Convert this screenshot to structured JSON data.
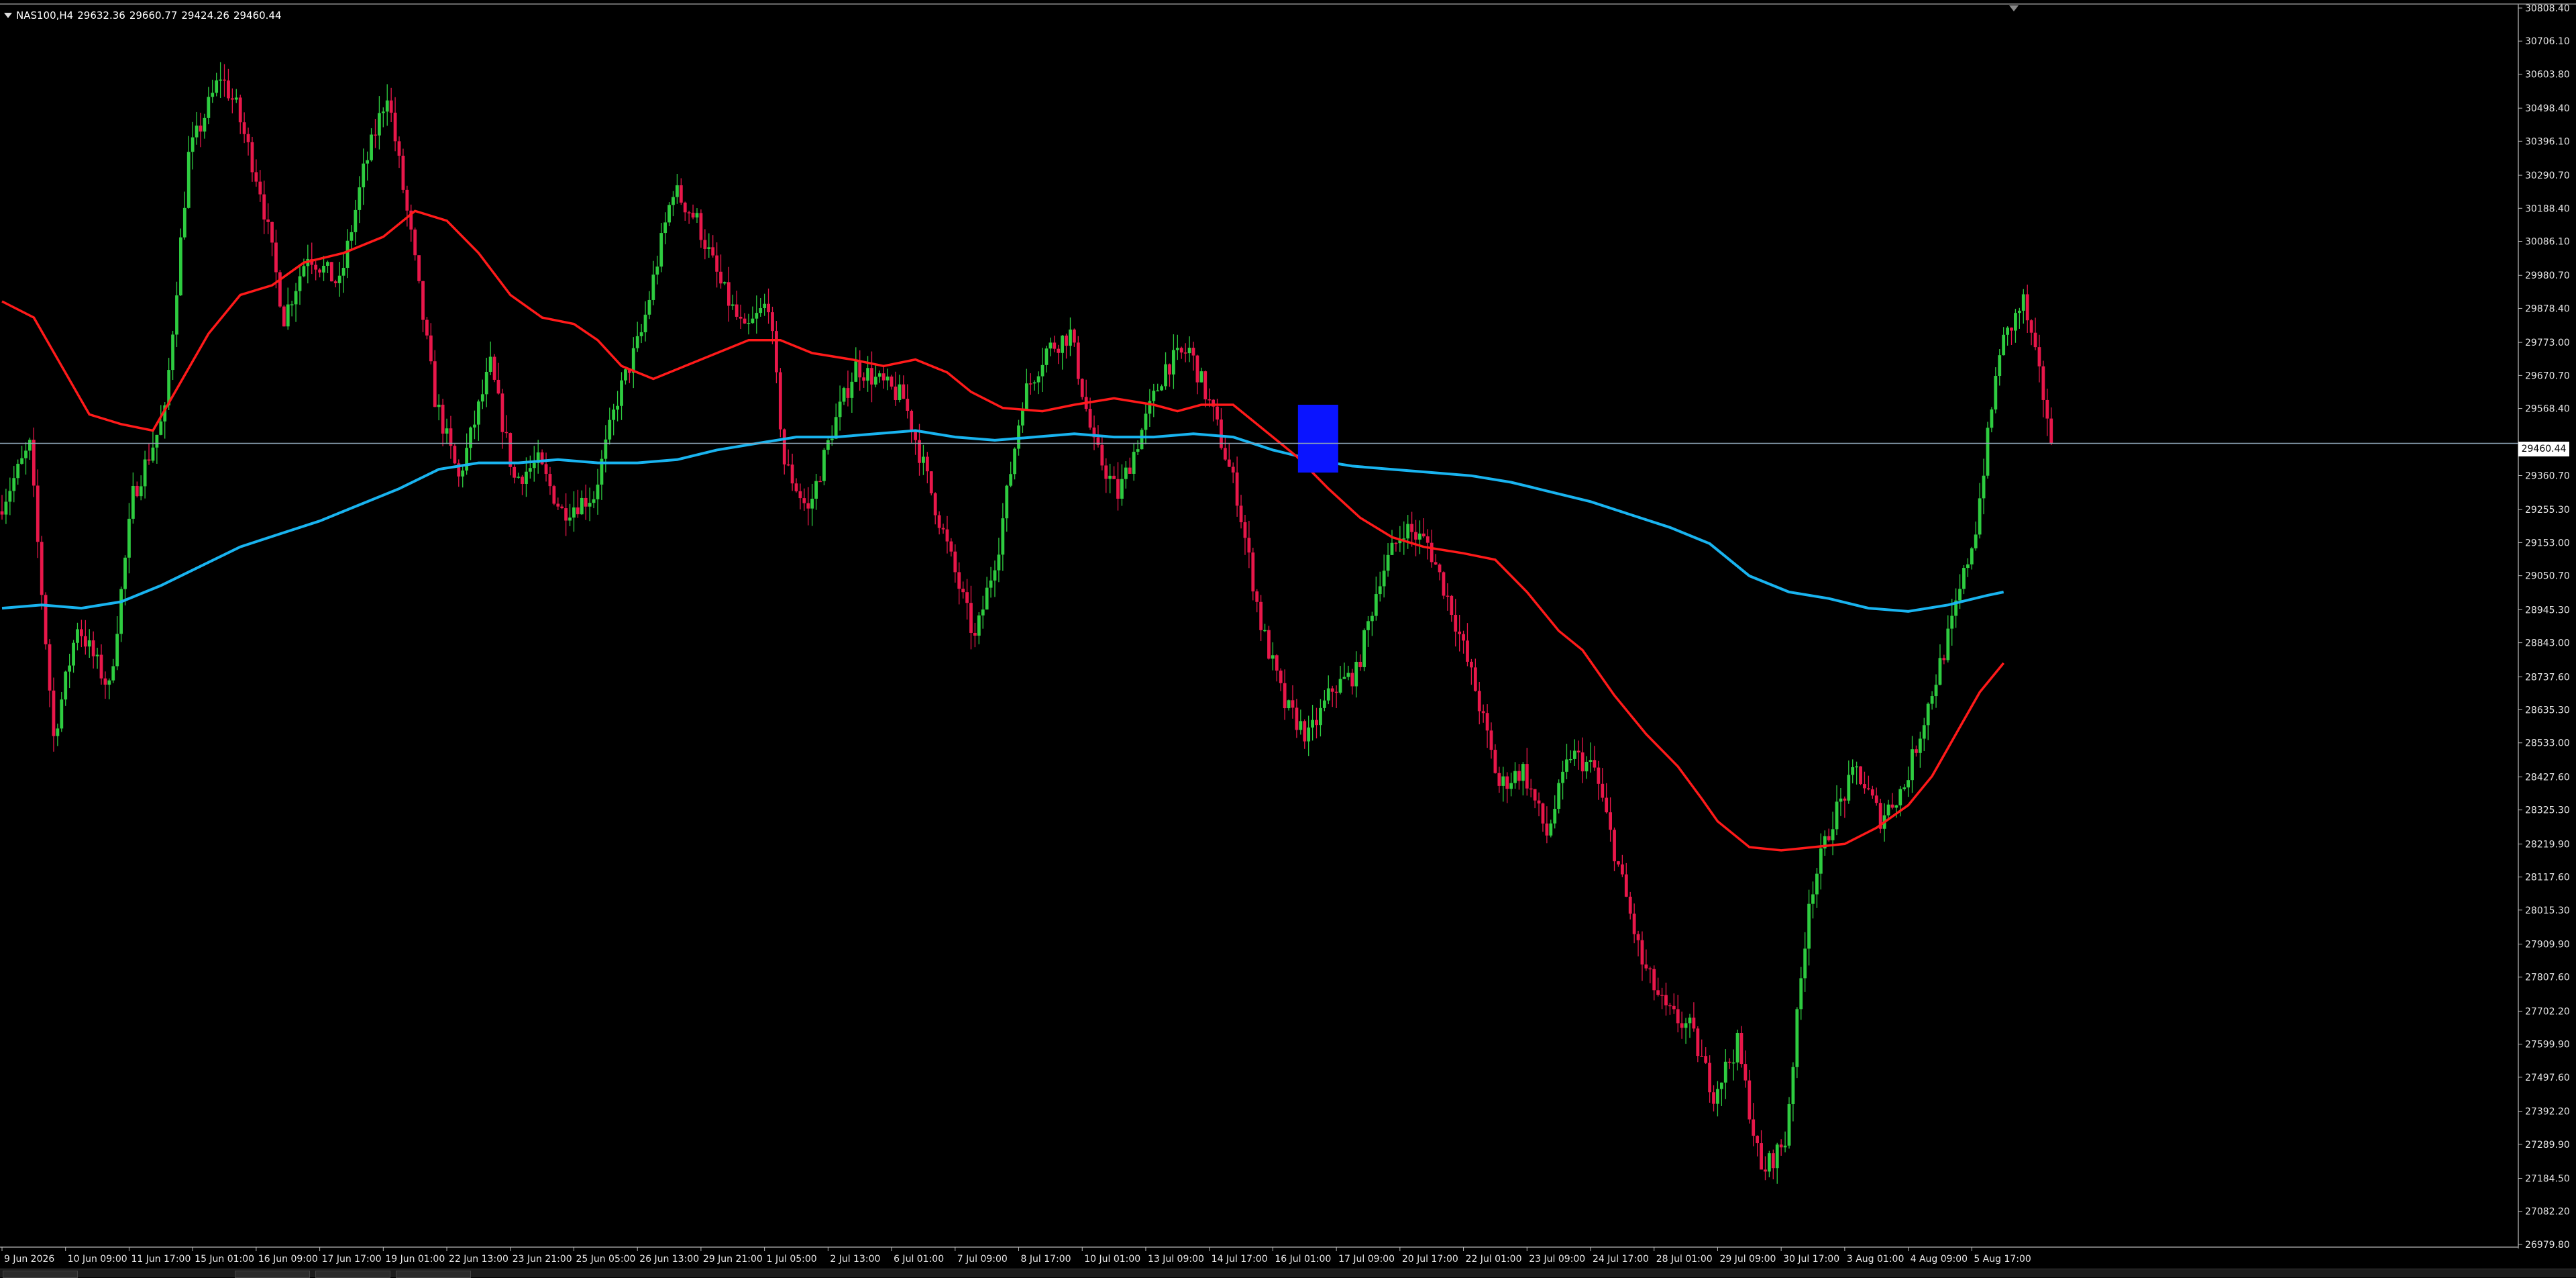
{
  "title": {
    "symbol": "NAS100,H4",
    "ohlc": [
      "29632.36",
      "29660.77",
      "29424.26",
      "29460.44"
    ]
  },
  "last_price": "29460.44",
  "price_scale": [
    "30808.40",
    "30706.10",
    "30603.80",
    "30498.40",
    "30396.10",
    "30290.70",
    "30188.40",
    "30086.10",
    "29980.70",
    "29878.40",
    "29773.00",
    "29670.70",
    "29568.40",
    "29360.70",
    "29255.30",
    "29153.00",
    "29050.70",
    "28945.30",
    "28843.00",
    "28737.60",
    "28635.30",
    "28533.00",
    "28427.60",
    "28325.30",
    "28219.90",
    "28117.60",
    "28015.30",
    "27909.90",
    "27807.60",
    "27702.20",
    "27599.90",
    "27497.60",
    "27392.20",
    "27289.90",
    "27184.50",
    "27082.20",
    "26979.80"
  ],
  "time_scale": [
    "9 Jun 2026",
    "10 Jun 09:00",
    "11 Jun 17:00",
    "15 Jun 01:00",
    "16 Jun 09:00",
    "17 Jun 17:00",
    "19 Jun 01:00",
    "22 Jun 13:00",
    "23 Jun 21:00",
    "25 Jun 05:00",
    "26 Jun 13:00",
    "29 Jun 21:00",
    "1 Jul 05:00",
    "2 Jul 13:00",
    "6 Jul 01:00",
    "7 Jul 09:00",
    "8 Jul 17:00",
    "10 Jul 01:00",
    "13 Jul 09:00",
    "14 Jul 17:00",
    "16 Jul 01:00",
    "17 Jul 09:00",
    "20 Jul 17:00",
    "22 Jul 01:00",
    "23 Jul 09:00",
    "24 Jul 17:00",
    "28 Jul 01:00",
    "29 Jul 09:00",
    "30 Jul 17:00",
    "3 Aug 01:00",
    "4 Aug 09:00",
    "5 Aug 17:00"
  ],
  "colors": {
    "background": "#000000",
    "bull": "#2ecc40",
    "bear": "#e8174a",
    "ma_fast": "#ff1a1a",
    "ma_slow": "#19b4f0",
    "price_line": "#8fa6b8",
    "selection_box": "#0a14ff",
    "text": "#e6e6e6"
  },
  "chart_data": {
    "type": "candlestick",
    "symbol": "NAS100",
    "timeframe": "H4",
    "ylim": [
      26979.8,
      30808.4
    ],
    "last_close": 29460.44,
    "anchors": [
      [
        0,
        29250
      ],
      [
        8,
        29450
      ],
      [
        14,
        28550
      ],
      [
        20,
        28900
      ],
      [
        28,
        28700
      ],
      [
        34,
        29300
      ],
      [
        42,
        29550
      ],
      [
        48,
        30350
      ],
      [
        56,
        30600
      ],
      [
        60,
        30500
      ],
      [
        66,
        30250
      ],
      [
        72,
        29850
      ],
      [
        78,
        30050
      ],
      [
        86,
        29950
      ],
      [
        92,
        30300
      ],
      [
        98,
        30550
      ],
      [
        104,
        30100
      ],
      [
        110,
        29600
      ],
      [
        116,
        29350
      ],
      [
        124,
        29700
      ],
      [
        130,
        29350
      ],
      [
        136,
        29400
      ],
      [
        142,
        29250
      ],
      [
        150,
        29300
      ],
      [
        156,
        29600
      ],
      [
        162,
        29800
      ],
      [
        170,
        30250
      ],
      [
        176,
        30150
      ],
      [
        182,
        29950
      ],
      [
        188,
        29800
      ],
      [
        194,
        29900
      ],
      [
        198,
        29400
      ],
      [
        204,
        29250
      ],
      [
        210,
        29500
      ],
      [
        216,
        29700
      ],
      [
        222,
        29650
      ],
      [
        228,
        29600
      ],
      [
        234,
        29350
      ],
      [
        240,
        29100
      ],
      [
        246,
        28850
      ],
      [
        252,
        29150
      ],
      [
        258,
        29600
      ],
      [
        264,
        29750
      ],
      [
        270,
        29800
      ],
      [
        276,
        29450
      ],
      [
        282,
        29300
      ],
      [
        288,
        29500
      ],
      [
        294,
        29700
      ],
      [
        300,
        29750
      ],
      [
        306,
        29550
      ],
      [
        312,
        29300
      ],
      [
        318,
        28900
      ],
      [
        324,
        28650
      ],
      [
        330,
        28550
      ],
      [
        336,
        28700
      ],
      [
        342,
        28750
      ],
      [
        348,
        29050
      ],
      [
        354,
        29200
      ],
      [
        360,
        29150
      ],
      [
        366,
        28950
      ],
      [
        372,
        28700
      ],
      [
        378,
        28400
      ],
      [
        384,
        28450
      ],
      [
        390,
        28250
      ],
      [
        396,
        28500
      ],
      [
        402,
        28450
      ],
      [
        408,
        28150
      ],
      [
        414,
        27850
      ],
      [
        420,
        27700
      ],
      [
        426,
        27650
      ],
      [
        432,
        27450
      ],
      [
        438,
        27600
      ],
      [
        444,
        27200
      ],
      [
        450,
        27300
      ],
      [
        456,
        28050
      ],
      [
        462,
        28300
      ],
      [
        468,
        28450
      ],
      [
        474,
        28300
      ],
      [
        480,
        28400
      ],
      [
        486,
        28650
      ],
      [
        492,
        28900
      ],
      [
        498,
        29200
      ],
      [
        504,
        29750
      ],
      [
        510,
        29900
      ],
      [
        516,
        29550
      ]
    ],
    "ma_fast": [
      [
        0,
        29900
      ],
      [
        8,
        29850
      ],
      [
        15,
        29700
      ],
      [
        22,
        29550
      ],
      [
        30,
        29520
      ],
      [
        38,
        29500
      ],
      [
        45,
        29650
      ],
      [
        52,
        29800
      ],
      [
        60,
        29920
      ],
      [
        68,
        29950
      ],
      [
        76,
        30020
      ],
      [
        86,
        30050
      ],
      [
        96,
        30100
      ],
      [
        104,
        30180
      ],
      [
        112,
        30150
      ],
      [
        120,
        30050
      ],
      [
        128,
        29920
      ],
      [
        136,
        29850
      ],
      [
        144,
        29830
      ],
      [
        150,
        29780
      ],
      [
        156,
        29700
      ],
      [
        164,
        29660
      ],
      [
        172,
        29700
      ],
      [
        180,
        29740
      ],
      [
        188,
        29780
      ],
      [
        196,
        29780
      ],
      [
        204,
        29740
      ],
      [
        214,
        29720
      ],
      [
        222,
        29700
      ],
      [
        230,
        29720
      ],
      [
        238,
        29680
      ],
      [
        244,
        29620
      ],
      [
        252,
        29570
      ],
      [
        262,
        29560
      ],
      [
        270,
        29580
      ],
      [
        280,
        29600
      ],
      [
        290,
        29580
      ],
      [
        296,
        29560
      ],
      [
        302,
        29580
      ],
      [
        310,
        29580
      ],
      [
        318,
        29500
      ],
      [
        326,
        29420
      ],
      [
        334,
        29320
      ],
      [
        342,
        29230
      ],
      [
        350,
        29170
      ],
      [
        358,
        29140
      ],
      [
        368,
        29120
      ],
      [
        376,
        29100
      ],
      [
        384,
        29000
      ],
      [
        392,
        28880
      ],
      [
        398,
        28820
      ],
      [
        406,
        28680
      ],
      [
        414,
        28560
      ],
      [
        422,
        28460
      ],
      [
        428,
        28360
      ],
      [
        432,
        28290
      ],
      [
        440,
        28210
      ],
      [
        448,
        28200
      ],
      [
        456,
        28210
      ],
      [
        464,
        28220
      ],
      [
        472,
        28270
      ],
      [
        480,
        28340
      ],
      [
        486,
        28430
      ],
      [
        492,
        28560
      ],
      [
        498,
        28690
      ],
      [
        504,
        28780
      ]
    ],
    "ma_slow": [
      [
        0,
        28950
      ],
      [
        10,
        28960
      ],
      [
        20,
        28950
      ],
      [
        30,
        28970
      ],
      [
        40,
        29020
      ],
      [
        50,
        29080
      ],
      [
        60,
        29140
      ],
      [
        70,
        29180
      ],
      [
        80,
        29220
      ],
      [
        90,
        29270
      ],
      [
        100,
        29320
      ],
      [
        110,
        29380
      ],
      [
        120,
        29400
      ],
      [
        130,
        29400
      ],
      [
        140,
        29410
      ],
      [
        150,
        29400
      ],
      [
        160,
        29400
      ],
      [
        170,
        29410
      ],
      [
        180,
        29440
      ],
      [
        190,
        29460
      ],
      [
        200,
        29480
      ],
      [
        210,
        29480
      ],
      [
        220,
        29490
      ],
      [
        230,
        29500
      ],
      [
        240,
        29480
      ],
      [
        250,
        29470
      ],
      [
        260,
        29480
      ],
      [
        270,
        29490
      ],
      [
        280,
        29480
      ],
      [
        290,
        29480
      ],
      [
        300,
        29490
      ],
      [
        310,
        29480
      ],
      [
        320,
        29440
      ],
      [
        330,
        29410
      ],
      [
        340,
        29390
      ],
      [
        350,
        29380
      ],
      [
        360,
        29370
      ],
      [
        370,
        29360
      ],
      [
        380,
        29340
      ],
      [
        390,
        29310
      ],
      [
        400,
        29280
      ],
      [
        410,
        29240
      ],
      [
        420,
        29200
      ],
      [
        430,
        29150
      ],
      [
        440,
        29050
      ],
      [
        450,
        29000
      ],
      [
        460,
        28980
      ],
      [
        470,
        28950
      ],
      [
        480,
        28940
      ],
      [
        490,
        28960
      ],
      [
        500,
        28990
      ],
      [
        504,
        29000
      ]
    ],
    "xlabel": "",
    "ylabel": ""
  }
}
